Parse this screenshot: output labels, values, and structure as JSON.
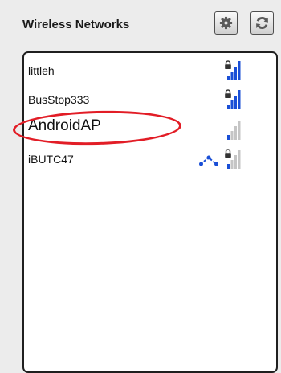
{
  "header": {
    "title": "Wireless Networks",
    "settings_icon": "gear-icon",
    "refresh_icon": "refresh-icon"
  },
  "networks": [
    {
      "name": "littleh",
      "secured": true,
      "signal": 4
    },
    {
      "name": "BusStop333",
      "secured": true,
      "signal": 4
    },
    {
      "name": "AndroidAP",
      "secured": false,
      "signal": 1
    },
    {
      "name": "iBUTC47",
      "secured": true,
      "signal": 1,
      "adhoc": true
    }
  ],
  "colors": {
    "signal_active": "#1a4fd6",
    "signal_inactive": "#c5c5c5",
    "highlight": "#e21d26"
  }
}
